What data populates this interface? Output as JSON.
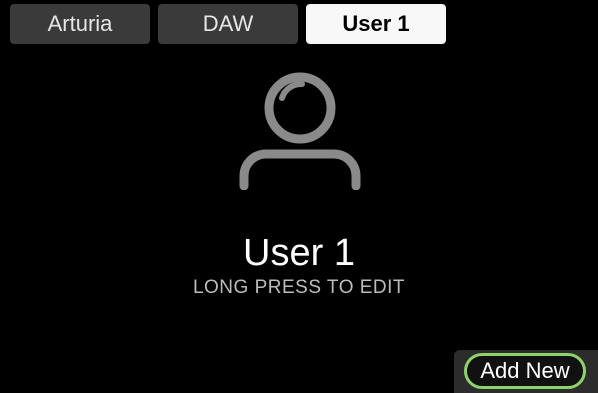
{
  "tabs": [
    {
      "label": "Arturia",
      "active": false
    },
    {
      "label": "DAW",
      "active": false
    },
    {
      "label": "User 1",
      "active": true
    }
  ],
  "avatar": {
    "icon": "user-icon",
    "color": "#8a8a8a"
  },
  "profile": {
    "name": "User 1",
    "hint": "LONG PRESS TO EDIT"
  },
  "actions": {
    "add_new_label": "Add New",
    "accent_color": "#8fd16a"
  }
}
